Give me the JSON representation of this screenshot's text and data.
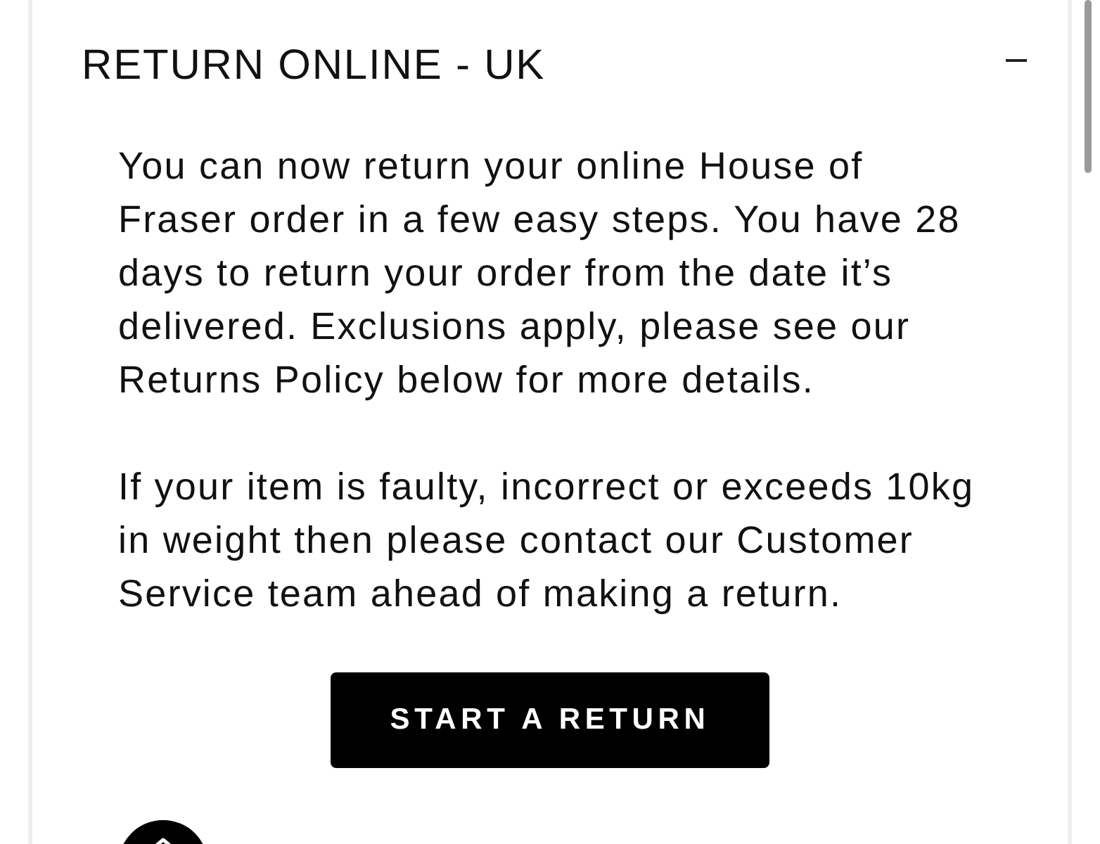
{
  "section": {
    "title": "RETURN ONLINE - UK",
    "expanded": true,
    "paragraphs": [
      "You can now return your online House of Fraser order in a few easy steps. You have 28 days to return your order from the date it’s delivered. Exclusions apply, please see our Returns Policy below for more details.",
      "If your item is faulty, incorrect or exceeds 10kg in weight then please contact our Customer Service team ahead of making a return."
    ],
    "button": "START A RETURN"
  }
}
